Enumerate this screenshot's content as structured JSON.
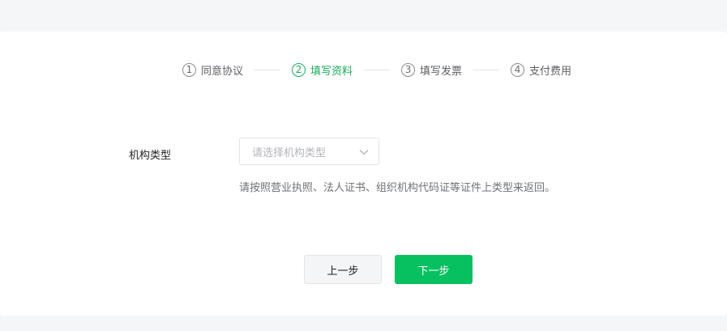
{
  "steps": [
    {
      "num": "1",
      "label": "同意协议",
      "active": false
    },
    {
      "num": "2",
      "label": "填写资料",
      "active": true
    },
    {
      "num": "3",
      "label": "填写发票",
      "active": false
    },
    {
      "num": "4",
      "label": "支付费用",
      "active": false
    }
  ],
  "form": {
    "org_type_label": "机构类型",
    "org_type_placeholder": "请选择机构类型",
    "hint": "请按照营业执照、法人证书、组织机构代码证等证件上类型来返回。"
  },
  "buttons": {
    "prev_label": "上一步",
    "next_label": "下一步"
  },
  "colors": {
    "accent": "#07c160",
    "active_step": "#1aad5f",
    "page_bg": "#f5f6f8"
  }
}
